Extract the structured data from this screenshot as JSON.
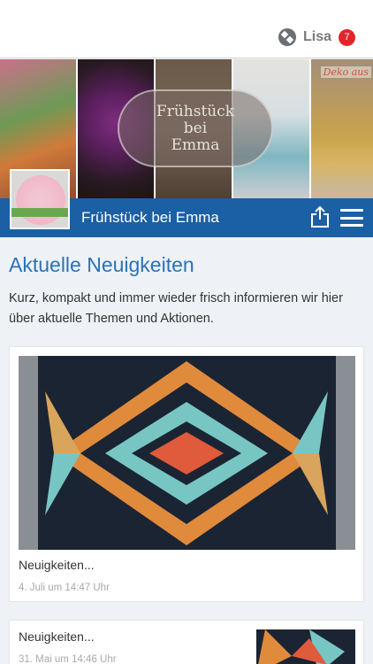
{
  "status": {
    "user_name": "Lisa",
    "notification_count": "7",
    "app_icon": "app-logo-icon"
  },
  "banner": {
    "title_line1": "Frühstück",
    "title_line2": "bei",
    "title_line3": "Emma",
    "corner_label": "Deko aus"
  },
  "nav": {
    "title": "Frühstück bei Emma",
    "share_icon": "share-icon",
    "menu_icon": "hamburger-menu-icon"
  },
  "main": {
    "heading": "Aktuelle Neuigkeiten",
    "intro": "Kurz, kompakt und immer wieder frisch informieren wir hier über aktuelle Themen und Aktionen."
  },
  "news": [
    {
      "title": "Neuigkeiten...",
      "date": "4. Juli um 14:47 Uhr"
    },
    {
      "title": "Neuigkeiten...",
      "date": "31. Mai um 14:46 Uhr"
    }
  ],
  "colors": {
    "nav_blue": "#1b5fa5",
    "heading_blue": "#2a73b8",
    "badge_red": "#e0262b"
  }
}
